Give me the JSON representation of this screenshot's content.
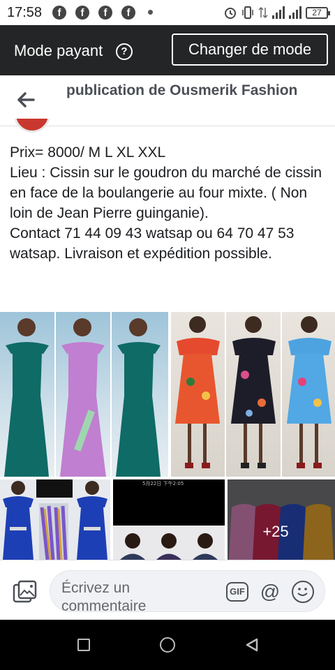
{
  "status_bar": {
    "time": "17:58",
    "notification_icons": [
      "facebook-icon",
      "facebook-icon",
      "facebook-icon",
      "facebook-icon"
    ],
    "battery": "27"
  },
  "mode_bar": {
    "label": "Mode payant",
    "help_symbol": "?",
    "button_label": "Changer de mode"
  },
  "header": {
    "title": "publication de Ousmerik Fashion"
  },
  "post": {
    "text": "Prix= 8000/ M L XL XXL\n Lieu : Cissin sur le goudron du marché de cissin en face de la boulangerie au four mixte. ( Non loin de Jean Pierre guinganie).\nContact 71 44 09 43 watsap ou 64 70 47 53 watsap. Livraison et expédition possible."
  },
  "photos": {
    "more_count": "+25",
    "overlay_caption": "5月22日 下午2:05"
  },
  "comment": {
    "placeholder": "Écrivez un commentaire",
    "gif_label": "GIF",
    "at_symbol": "@"
  },
  "colors": {
    "dark_bar": "#242526",
    "teal_dress": "#0f6b66",
    "lilac_dress": "#c07fd0",
    "blue_dress": "#1d3fb5"
  }
}
